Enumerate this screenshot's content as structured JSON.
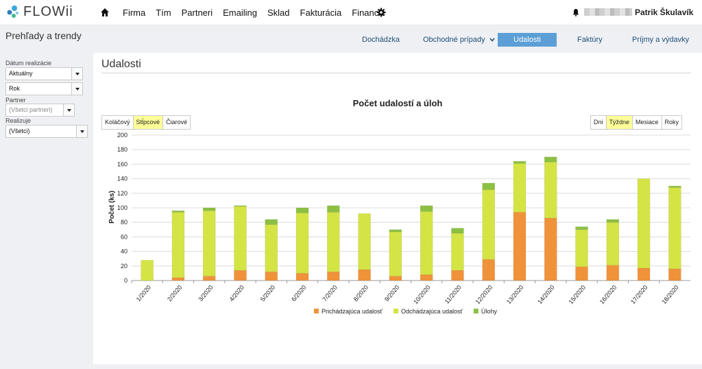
{
  "app": {
    "logo_text": "FLOWii"
  },
  "topnav": {
    "items": [
      "Firma",
      "Tím",
      "Partneri",
      "Emailing",
      "Sklad",
      "Fakturácia",
      "Financie"
    ],
    "user_name": "Patrik Škulavík"
  },
  "subnav": {
    "page_heading": "Prehľady a trendy",
    "tabs": [
      "Dochádzka",
      "Obchodné prípady",
      "Udalosti",
      "Faktúry",
      "Príjmy a výdavky"
    ],
    "active_tab": "Udalosti"
  },
  "filters": {
    "date_label": "Dátum realizácie",
    "date_value": "Aktuálny",
    "period_value": "Rok",
    "partner_label": "Partner",
    "partner_placeholder": "(Všetci partneri)",
    "realizuje_label": "Realizuje",
    "realizuje_value": "(Všetci)"
  },
  "main": {
    "title": "Udalosti",
    "chart_types": [
      "Koláčový",
      "Stĺpcové",
      "Čiarové"
    ],
    "chart_type_active": "Stĺpcové",
    "periods": [
      "Dni",
      "Týždne",
      "Mesiace",
      "Roky"
    ],
    "period_active": "Týždne"
  },
  "colors": {
    "incoming": "#f0923a",
    "outgoing": "#d4e445",
    "tasks": "#8cc043",
    "accent": "#5c9fd6"
  },
  "chart_data": {
    "type": "bar",
    "stacked": true,
    "title": "Počet udalostí a úloh",
    "ylabel": "Počet (ks)",
    "xlabel": "",
    "ylim": [
      0,
      200
    ],
    "yticks": [
      0,
      20,
      40,
      60,
      80,
      100,
      120,
      140,
      160,
      180,
      200
    ],
    "grid": true,
    "legend": "bottom",
    "categories": [
      "1/2020",
      "2/2020",
      "3/2020",
      "4/2020",
      "5/2020",
      "6/2020",
      "7/2020",
      "8/2020",
      "9/2020",
      "10/2020",
      "11/2020",
      "12/2020",
      "13/2020",
      "14/2020",
      "15/2020",
      "16/2020",
      "17/2020",
      "18/2020"
    ],
    "series": [
      {
        "name": "Prichádzajúca udalosť",
        "values": [
          0,
          4,
          6,
          14,
          12,
          10,
          12,
          15,
          6,
          8,
          14,
          29,
          94,
          86,
          19,
          21,
          17,
          16
        ]
      },
      {
        "name": "Odchádzajúca udalosť",
        "values": [
          28,
          90,
          90,
          88,
          65,
          83,
          82,
          77,
          61,
          87,
          51,
          96,
          67,
          77,
          51,
          59,
          123,
          112
        ]
      },
      {
        "name": "Úlohy",
        "values": [
          0,
          2,
          4,
          1,
          7,
          7,
          9,
          0,
          3,
          8,
          7,
          9,
          3,
          7,
          4,
          4,
          0,
          2
        ]
      }
    ]
  }
}
